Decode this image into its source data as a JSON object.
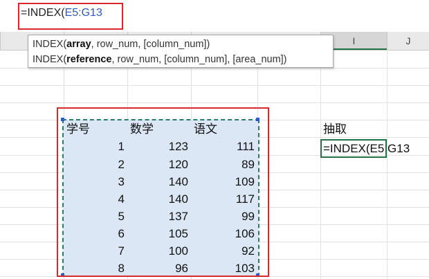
{
  "formula_bar": {
    "prefix": "=INDEX(",
    "reference": "E5:G13"
  },
  "columns": [
    "",
    "",
    "",
    "",
    "I",
    "J"
  ],
  "tooltip": {
    "line1": {
      "fn": "INDEX(",
      "arg_bold": "array",
      "rest": ", row_num, [column_num])"
    },
    "line2": {
      "fn": "INDEX(",
      "arg_bold": "reference",
      "rest": ", row_num, [column_num], [area_num])"
    }
  },
  "table": {
    "headers": [
      "学号",
      "数学",
      "语文"
    ],
    "rows": [
      [
        "1",
        "123",
        "111"
      ],
      [
        "2",
        "120",
        "89"
      ],
      [
        "3",
        "140",
        "109"
      ],
      [
        "4",
        "140",
        "117"
      ],
      [
        "5",
        "137",
        "99"
      ],
      [
        "6",
        "105",
        "106"
      ],
      [
        "7",
        "100",
        "92"
      ],
      [
        "8",
        "96",
        "103"
      ]
    ]
  },
  "side": {
    "label": "抽取",
    "editing_formula": "=INDEX(E5:G13"
  },
  "colors": {
    "highlight_red": "#d9282b",
    "range_fill": "#dbe7f5",
    "range_border": "#2b7a6e",
    "ref_blue": "#2f5bbf",
    "excel_green": "#217346"
  }
}
